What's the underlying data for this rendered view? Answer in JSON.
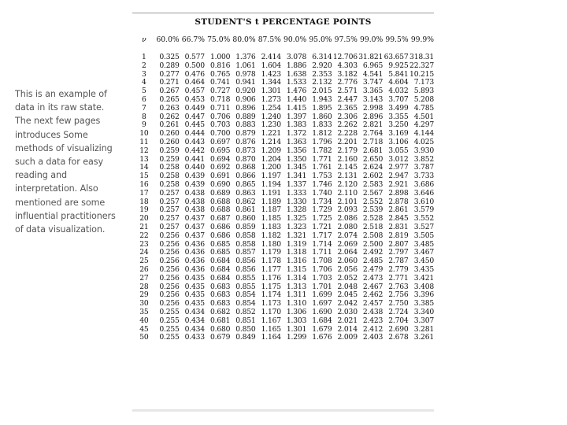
{
  "caption": {
    "text": "This is an example of data in its raw state. The next few pages introduces Some methods of visualizing such a data for easy reading and interpretation. Also mentioned are some influential practitioners of data visualization."
  },
  "table": {
    "title": "STUDENT'S t PERCENTAGE POINTS",
    "nu_header": "ν",
    "columns": [
      "60.0%",
      "66.7%",
      "75.0%",
      "80.0%",
      "87.5%",
      "90.0%",
      "95.0%",
      "97.5%",
      "99.0%",
      "99.5%",
      "99.9%"
    ],
    "rows": [
      {
        "nu": "1",
        "values": [
          "0.325",
          "0.577",
          "1.000",
          "1.376",
          "2.414",
          "3.078",
          "6.314",
          "12.706",
          "31.821",
          "63.657",
          "318.31"
        ]
      },
      {
        "nu": "2",
        "values": [
          "0.289",
          "0.500",
          "0.816",
          "1.061",
          "1.604",
          "1.886",
          "2.920",
          "4.303",
          "6.965",
          "9.925",
          "22.327"
        ]
      },
      {
        "nu": "3",
        "values": [
          "0.277",
          "0.476",
          "0.765",
          "0.978",
          "1.423",
          "1.638",
          "2.353",
          "3.182",
          "4.541",
          "5.841",
          "10.215"
        ]
      },
      {
        "nu": "4",
        "values": [
          "0.271",
          "0.464",
          "0.741",
          "0.941",
          "1.344",
          "1.533",
          "2.132",
          "2.776",
          "3.747",
          "4.604",
          "7.173"
        ]
      },
      {
        "nu": "5",
        "values": [
          "0.267",
          "0.457",
          "0.727",
          "0.920",
          "1.301",
          "1.476",
          "2.015",
          "2.571",
          "3.365",
          "4.032",
          "5.893"
        ]
      },
      {
        "nu": "6",
        "values": [
          "0.265",
          "0.453",
          "0.718",
          "0.906",
          "1.273",
          "1.440",
          "1.943",
          "2.447",
          "3.143",
          "3.707",
          "5.208"
        ]
      },
      {
        "nu": "7",
        "values": [
          "0.263",
          "0.449",
          "0.711",
          "0.896",
          "1.254",
          "1.415",
          "1.895",
          "2.365",
          "2.998",
          "3.499",
          "4.785"
        ]
      },
      {
        "nu": "8",
        "values": [
          "0.262",
          "0.447",
          "0.706",
          "0.889",
          "1.240",
          "1.397",
          "1.860",
          "2.306",
          "2.896",
          "3.355",
          "4.501"
        ]
      },
      {
        "nu": "9",
        "values": [
          "0.261",
          "0.445",
          "0.703",
          "0.883",
          "1.230",
          "1.383",
          "1.833",
          "2.262",
          "2.821",
          "3.250",
          "4.297"
        ]
      },
      {
        "nu": "10",
        "values": [
          "0.260",
          "0.444",
          "0.700",
          "0.879",
          "1.221",
          "1.372",
          "1.812",
          "2.228",
          "2.764",
          "3.169",
          "4.144"
        ]
      },
      {
        "nu": "11",
        "values": [
          "0.260",
          "0.443",
          "0.697",
          "0.876",
          "1.214",
          "1.363",
          "1.796",
          "2.201",
          "2.718",
          "3.106",
          "4.025"
        ]
      },
      {
        "nu": "12",
        "values": [
          "0.259",
          "0.442",
          "0.695",
          "0.873",
          "1.209",
          "1.356",
          "1.782",
          "2.179",
          "2.681",
          "3.055",
          "3.930"
        ]
      },
      {
        "nu": "13",
        "values": [
          "0.259",
          "0.441",
          "0.694",
          "0.870",
          "1.204",
          "1.350",
          "1.771",
          "2.160",
          "2.650",
          "3.012",
          "3.852"
        ]
      },
      {
        "nu": "14",
        "values": [
          "0.258",
          "0.440",
          "0.692",
          "0.868",
          "1.200",
          "1.345",
          "1.761",
          "2.145",
          "2.624",
          "2.977",
          "3.787"
        ]
      },
      {
        "nu": "15",
        "values": [
          "0.258",
          "0.439",
          "0.691",
          "0.866",
          "1.197",
          "1.341",
          "1.753",
          "2.131",
          "2.602",
          "2.947",
          "3.733"
        ]
      },
      {
        "nu": "16",
        "values": [
          "0.258",
          "0.439",
          "0.690",
          "0.865",
          "1.194",
          "1.337",
          "1.746",
          "2.120",
          "2.583",
          "2.921",
          "3.686"
        ]
      },
      {
        "nu": "17",
        "values": [
          "0.257",
          "0.438",
          "0.689",
          "0.863",
          "1.191",
          "1.333",
          "1.740",
          "2.110",
          "2.567",
          "2.898",
          "3.646"
        ]
      },
      {
        "nu": "18",
        "values": [
          "0.257",
          "0.438",
          "0.688",
          "0.862",
          "1.189",
          "1.330",
          "1.734",
          "2.101",
          "2.552",
          "2.878",
          "3.610"
        ]
      },
      {
        "nu": "19",
        "values": [
          "0.257",
          "0.438",
          "0.688",
          "0.861",
          "1.187",
          "1.328",
          "1.729",
          "2.093",
          "2.539",
          "2.861",
          "3.579"
        ]
      },
      {
        "nu": "20",
        "values": [
          "0.257",
          "0.437",
          "0.687",
          "0.860",
          "1.185",
          "1.325",
          "1.725",
          "2.086",
          "2.528",
          "2.845",
          "3.552"
        ]
      },
      {
        "nu": "21",
        "values": [
          "0.257",
          "0.437",
          "0.686",
          "0.859",
          "1.183",
          "1.323",
          "1.721",
          "2.080",
          "2.518",
          "2.831",
          "3.527"
        ]
      },
      {
        "nu": "22",
        "values": [
          "0.256",
          "0.437",
          "0.686",
          "0.858",
          "1.182",
          "1.321",
          "1.717",
          "2.074",
          "2.508",
          "2.819",
          "3.505"
        ]
      },
      {
        "nu": "23",
        "values": [
          "0.256",
          "0.436",
          "0.685",
          "0.858",
          "1.180",
          "1.319",
          "1.714",
          "2.069",
          "2.500",
          "2.807",
          "3.485"
        ]
      },
      {
        "nu": "24",
        "values": [
          "0.256",
          "0.436",
          "0.685",
          "0.857",
          "1.179",
          "1.318",
          "1.711",
          "2.064",
          "2.492",
          "2.797",
          "3.467"
        ]
      },
      {
        "nu": "25",
        "values": [
          "0.256",
          "0.436",
          "0.684",
          "0.856",
          "1.178",
          "1.316",
          "1.708",
          "2.060",
          "2.485",
          "2.787",
          "3.450"
        ]
      },
      {
        "nu": "26",
        "values": [
          "0.256",
          "0.436",
          "0.684",
          "0.856",
          "1.177",
          "1.315",
          "1.706",
          "2.056",
          "2.479",
          "2.779",
          "3.435"
        ]
      },
      {
        "nu": "27",
        "values": [
          "0.256",
          "0.435",
          "0.684",
          "0.855",
          "1.176",
          "1.314",
          "1.703",
          "2.052",
          "2.473",
          "2.771",
          "3.421"
        ]
      },
      {
        "nu": "28",
        "values": [
          "0.256",
          "0.435",
          "0.683",
          "0.855",
          "1.175",
          "1.313",
          "1.701",
          "2.048",
          "2.467",
          "2.763",
          "3.408"
        ]
      },
      {
        "nu": "29",
        "values": [
          "0.256",
          "0.435",
          "0.683",
          "0.854",
          "1.174",
          "1.311",
          "1.699",
          "2.045",
          "2.462",
          "2.756",
          "3.396"
        ]
      },
      {
        "nu": "30",
        "values": [
          "0.256",
          "0.435",
          "0.683",
          "0.854",
          "1.173",
          "1.310",
          "1.697",
          "2.042",
          "2.457",
          "2.750",
          "3.385"
        ]
      },
      {
        "nu": "35",
        "values": [
          "0.255",
          "0.434",
          "0.682",
          "0.852",
          "1.170",
          "1.306",
          "1.690",
          "2.030",
          "2.438",
          "2.724",
          "3.340"
        ]
      },
      {
        "nu": "40",
        "values": [
          "0.255",
          "0.434",
          "0.681",
          "0.851",
          "1.167",
          "1.303",
          "1.684",
          "2.021",
          "2.423",
          "2.704",
          "3.307"
        ]
      },
      {
        "nu": "45",
        "values": [
          "0.255",
          "0.434",
          "0.680",
          "0.850",
          "1.165",
          "1.301",
          "1.679",
          "2.014",
          "2.412",
          "2.690",
          "3.281"
        ]
      },
      {
        "nu": "50",
        "values": [
          "0.255",
          "0.433",
          "0.679",
          "0.849",
          "1.164",
          "1.299",
          "1.676",
          "2.009",
          "2.403",
          "2.678",
          "3.261"
        ]
      }
    ]
  }
}
